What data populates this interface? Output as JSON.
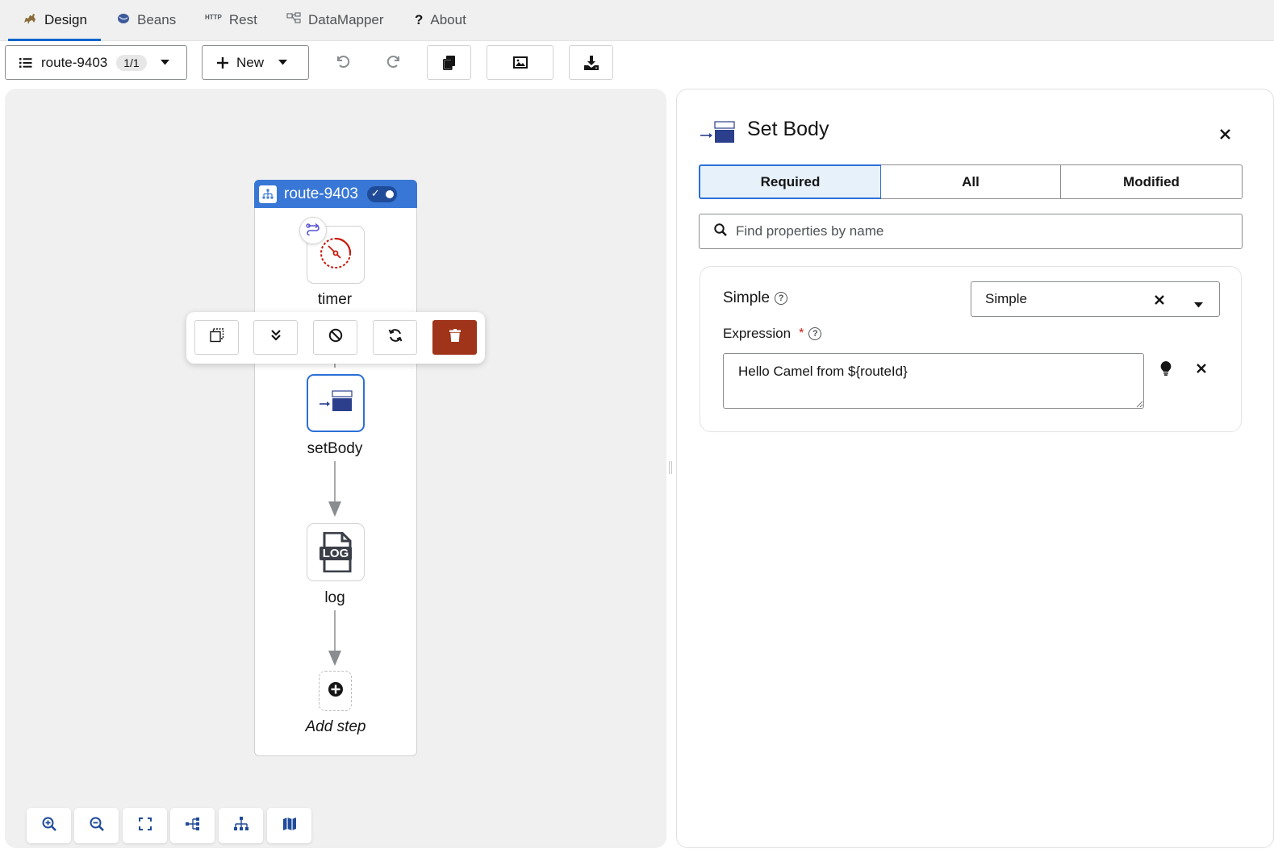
{
  "tabs": [
    {
      "label": "Design",
      "icon": "camel-icon"
    },
    {
      "label": "Beans",
      "icon": "bean-icon"
    },
    {
      "label": "Rest",
      "icon": "http-icon"
    },
    {
      "label": "DataMapper",
      "icon": "datamapper-icon"
    },
    {
      "label": "About",
      "icon": "question-icon"
    }
  ],
  "rest_icon_text": "HTTP",
  "toolbar": {
    "route_name": "route-9403",
    "route_count": "1/1",
    "new_label": "New"
  },
  "route": {
    "name": "route-9403",
    "enabled": true,
    "steps": [
      {
        "label": "timer",
        "icon": "timer-icon"
      },
      {
        "label": "setBody",
        "icon": "set-body-icon"
      },
      {
        "label": "log",
        "icon": "log-icon"
      }
    ],
    "log_icon_text": "LOG",
    "add_step_label": "Add step"
  },
  "panel": {
    "title": "Set Body",
    "filter_tabs": [
      "Required",
      "All",
      "Modified"
    ],
    "active_filter": "Required",
    "search_placeholder": "Find properties by name",
    "language_label": "Simple",
    "language_value": "Simple",
    "expression_label": "Expression",
    "required_mark": "*",
    "expression_value": "Hello Camel from ${routeId}"
  },
  "colors": {
    "accent": "#0066cc",
    "route_header": "#3877d6",
    "danger": "#a0341a",
    "timer": "#c9190b"
  }
}
